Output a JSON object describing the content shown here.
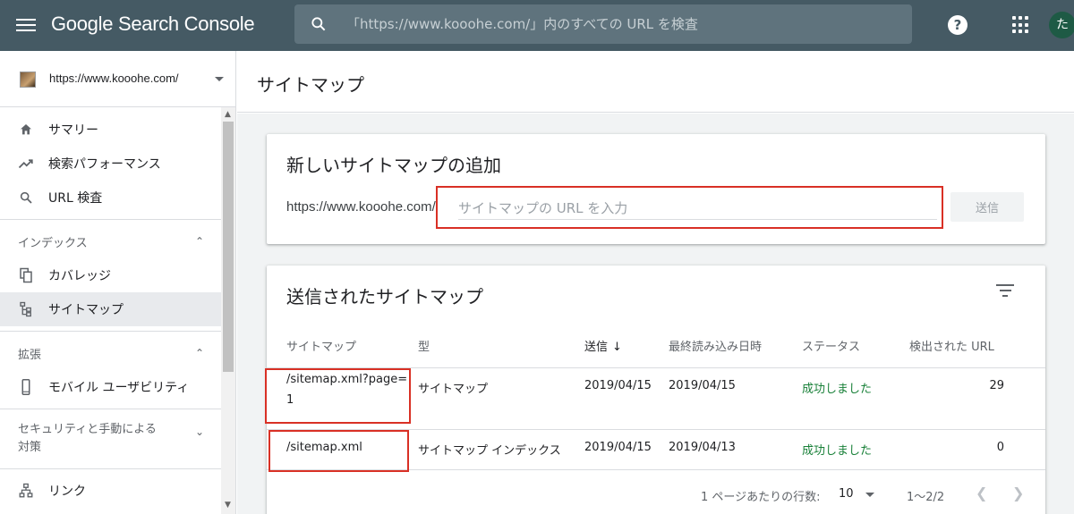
{
  "app": {
    "title": "Google Search Console"
  },
  "search": {
    "placeholder": "「https://www.kooohe.com/」内のすべての URL を検査"
  },
  "topbar": {
    "help_label": "?",
    "avatar_initial": "た"
  },
  "sidebar": {
    "property_url": "https://www.kooohe.com/",
    "items": [
      {
        "label": "サマリー",
        "icon": "home-icon"
      },
      {
        "label": "検索パフォーマンス",
        "icon": "trending-up-icon"
      },
      {
        "label": "URL 検査",
        "icon": "search-icon"
      }
    ],
    "sections": [
      {
        "label": "インデックス",
        "items": [
          {
            "label": "カバレッジ",
            "icon": "copy-icon"
          },
          {
            "label": "サイトマップ",
            "icon": "sitemap-icon",
            "active": true
          }
        ]
      },
      {
        "label": "拡張",
        "items": [
          {
            "label": "モバイル ユーザビリティ",
            "icon": "smartphone-icon"
          }
        ]
      },
      {
        "label_line1": "セキュリティと手動による",
        "label_line2": "対策"
      }
    ],
    "partial_item": {
      "label": "リンク",
      "icon": "link-tree-icon"
    }
  },
  "page": {
    "title": "サイトマップ"
  },
  "add_sitemap": {
    "title": "新しいサイトマップの追加",
    "prefix": "https://www.kooohe.com/",
    "input_placeholder": "サイトマップの URL を入力",
    "submit_label": "送信"
  },
  "submitted": {
    "title": "送信されたサイトマップ",
    "columns": [
      "サイトマップ",
      "型",
      "送信",
      "最終読み込み日時",
      "ステータス",
      "検出された URL"
    ],
    "rows": [
      {
        "sitemap_line1": "/sitemap.xml?page=",
        "sitemap_line2": "1",
        "type": "サイトマップ",
        "submitted": "2019/04/15",
        "last_read": "2019/04/15",
        "status": "成功しました",
        "urls": "29"
      },
      {
        "sitemap_line1": "/sitemap.xml",
        "sitemap_line2": "",
        "type": "サイトマップ インデックス",
        "submitted": "2019/04/15",
        "last_read": "2019/04/13",
        "status": "成功しました",
        "urls": "0"
      }
    ],
    "pager": {
      "rows_label": "1 ページあたりの行数:",
      "rows_value": "10",
      "range": "1〜2/2"
    }
  },
  "colors": {
    "topbar": "#455a64",
    "success": "#188038",
    "highlight": "#d93025"
  }
}
